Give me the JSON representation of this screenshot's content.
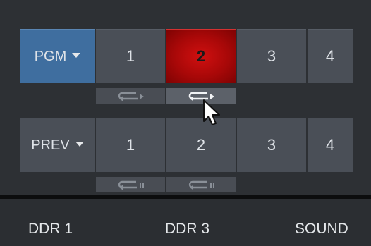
{
  "pgm_row": {
    "bus_label": "PGM",
    "inputs": [
      "1",
      "2",
      "3",
      "4"
    ],
    "active_input": "2"
  },
  "prev_row": {
    "bus_label": "PREV",
    "inputs": [
      "1",
      "2",
      "3",
      "4"
    ]
  },
  "pgm_transport": {
    "controls": [
      {
        "icon": "loop-play-icon",
        "state": "dim"
      },
      {
        "icon": "loop-play-icon",
        "state": "highlighted"
      }
    ]
  },
  "prev_transport": {
    "controls": [
      {
        "icon": "loop-pause-icon",
        "state": "dim"
      },
      {
        "icon": "loop-pause-icon",
        "state": "dim"
      }
    ]
  },
  "bottom_bar": {
    "labels": [
      "DDR 1",
      "DDR 3",
      "SOUND"
    ]
  },
  "colors": {
    "pgm_bus": "#3f6e9f",
    "active_program": "#c00a0a",
    "button": "#4a4f57",
    "background": "#2d3034"
  }
}
